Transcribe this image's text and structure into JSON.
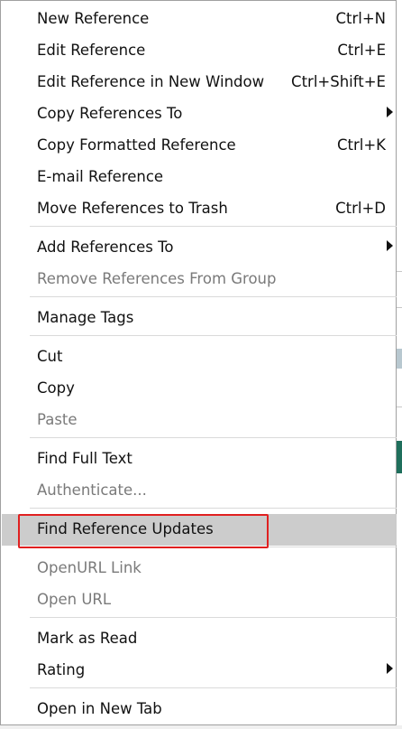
{
  "menu": {
    "items": [
      {
        "label": "New Reference",
        "shortcut": "Ctrl+N",
        "enabled": true
      },
      {
        "label": "Edit Reference",
        "shortcut": "Ctrl+E",
        "enabled": true
      },
      {
        "label": "Edit Reference in New Window",
        "shortcut": "Ctrl+Shift+E",
        "enabled": true
      },
      {
        "label": "Copy References To",
        "shortcut": "",
        "enabled": true,
        "submenu": true
      },
      {
        "label": "Copy Formatted Reference",
        "shortcut": "Ctrl+K",
        "enabled": true
      },
      {
        "label": "E-mail Reference",
        "shortcut": "",
        "enabled": true
      },
      {
        "label": "Move References to Trash",
        "shortcut": "Ctrl+D",
        "enabled": true
      },
      {
        "label": "Add References To",
        "shortcut": "",
        "enabled": true,
        "submenu": true
      },
      {
        "label": "Remove References From Group",
        "shortcut": "",
        "enabled": false
      },
      {
        "label": "Manage Tags",
        "shortcut": "",
        "enabled": true
      },
      {
        "label": "Cut",
        "shortcut": "",
        "enabled": true
      },
      {
        "label": "Copy",
        "shortcut": "",
        "enabled": true
      },
      {
        "label": "Paste",
        "shortcut": "",
        "enabled": false
      },
      {
        "label": "Find Full Text",
        "shortcut": "",
        "enabled": true
      },
      {
        "label": "Authenticate...",
        "shortcut": "",
        "enabled": false
      },
      {
        "label": "Find Reference Updates",
        "shortcut": "",
        "enabled": true,
        "highlighted": true
      },
      {
        "label": "OpenURL Link",
        "shortcut": "",
        "enabled": false
      },
      {
        "label": "Open URL",
        "shortcut": "",
        "enabled": false
      },
      {
        "label": "Mark as Read",
        "shortcut": "",
        "enabled": true
      },
      {
        "label": "Rating",
        "shortcut": "",
        "enabled": true,
        "submenu": true
      },
      {
        "label": "Open in New Tab",
        "shortcut": "",
        "enabled": true
      }
    ]
  },
  "colors": {
    "highlight_bg": "#cccccc",
    "focus_outline": "#e02020",
    "disabled_text": "#7a7a7a",
    "background_accent": "#1f6f5c"
  }
}
